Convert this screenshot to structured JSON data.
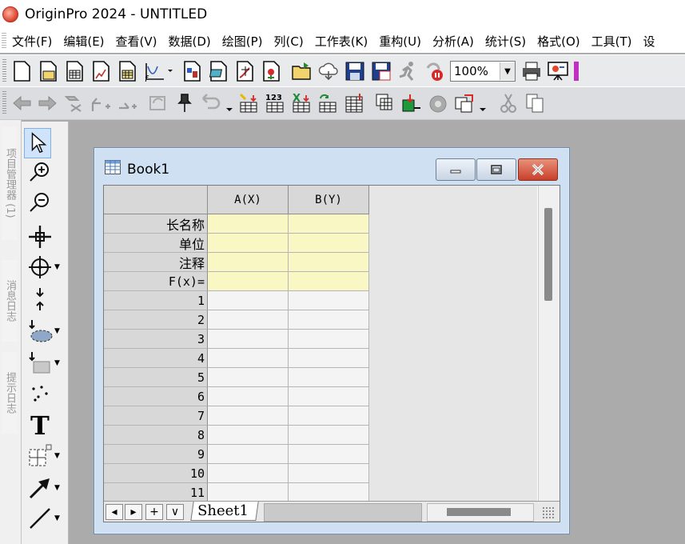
{
  "app": {
    "title": "OriginPro 2024 - UNTITLED"
  },
  "menu": {
    "items": [
      "文件(F)",
      "编辑(E)",
      "查看(V)",
      "数据(D)",
      "绘图(P)",
      "列(C)",
      "工作表(K)",
      "重构(U)",
      "分析(A)",
      "统计(S)",
      "格式(O)",
      "工具(T)",
      "设"
    ]
  },
  "toolbar": {
    "zoom_value": "100%"
  },
  "dock": {
    "tabs": [
      "项目管理器 (1)",
      "消息日志",
      "提示日志"
    ]
  },
  "book": {
    "title": "Book1",
    "columns": [
      "A(X)",
      "B(Y)"
    ],
    "meta_rows": [
      "长名称",
      "单位",
      "注释",
      "F(x)="
    ],
    "row_numbers": [
      "1",
      "2",
      "3",
      "4",
      "5",
      "6",
      "7",
      "8",
      "9",
      "10",
      "11"
    ],
    "sheet_tab": "Sheet1"
  },
  "colors": {
    "window_border": "#6f8fb2",
    "meta_fill": "#f9f8c4",
    "close_red": "#c8402a"
  }
}
